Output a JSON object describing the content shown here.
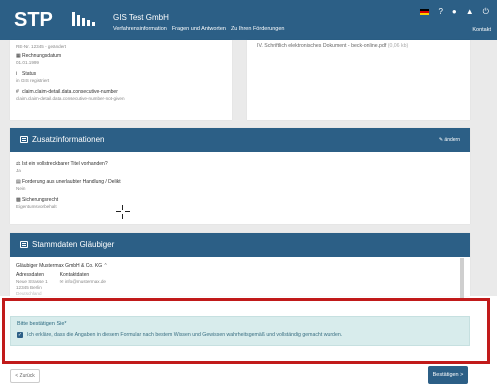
{
  "header": {
    "logo": "STP",
    "app_title": "GIS Test GmbH",
    "nav": [
      "Verfahrensinformation",
      "Fragen und Antworten",
      "Zu Ihren Förderungen"
    ],
    "icons": [
      "flag-de-icon",
      "help-icon",
      "user-icon",
      "bank-icon",
      "power-icon"
    ],
    "kontakt": "Kontakt"
  },
  "claim_card": {
    "fields": [
      {
        "label": "",
        "value": "RE-Nr. 12345 - geändert"
      },
      {
        "label": "Rechnungsdatum",
        "value": "01.01.1999"
      },
      {
        "label": "Status",
        "value": "in GIS registriert"
      },
      {
        "label": "claim.claim-detail.data.consecutive-number",
        "value": "claim.claim-detail.data.consecutive-number-not-given"
      }
    ]
  },
  "doc_card": {
    "document": "IV. Schriftlich elektronisches Dokument - beck-online.pdf",
    "size": "(0,06 kb)"
  },
  "zusatz": {
    "title": "Zusatzinformationen",
    "edit": "ändern",
    "fields": [
      {
        "label": "Ist ein vollstreckbarer Titel vorhanden?",
        "value": "Ja"
      },
      {
        "label": "Forderung aus unerlaubter Handlung / Delikt",
        "value": "Nein"
      },
      {
        "label": "Sicherungsrecht",
        "value": "Eigentumsvorbehalt"
      }
    ]
  },
  "stammdaten": {
    "title": "Stammdaten Gläubiger",
    "creditor": "Gläubiger Mustermax GmbH & Co. KG",
    "address_label": "Adressdaten",
    "address_lines": [
      "Neue Strasse 1",
      "12345 Berlin",
      "Deutschland"
    ],
    "contact_label": "Kontaktdaten",
    "email": "info@mustermax.de"
  },
  "confirm": {
    "title": "Bitte bestätigen Sie*",
    "text": "Ich erkläre, dass die Angaben in diesem Formular nach bestem Wissen und Gewissen wahrheitsgemäß und vollständig gemacht wurden.",
    "checked": true
  },
  "buttons": {
    "back": "< Zurück",
    "next": "Bestätigen >"
  },
  "colors": {
    "primary": "#2c5f86",
    "highlight": "#c11a1a",
    "confirm_bg": "#d8ecec"
  }
}
